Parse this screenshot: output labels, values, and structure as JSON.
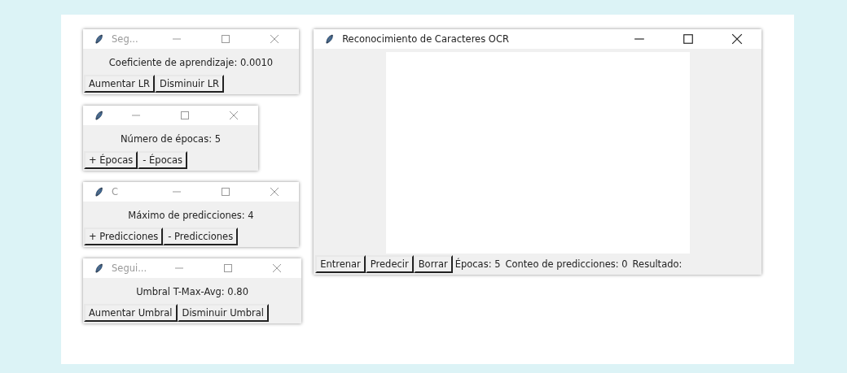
{
  "small_windows": [
    {
      "title": "Seg...",
      "label": "Coeficiente de aprendizaje: 0.0010",
      "buttons": [
        "Aumentar LR",
        "Disminuir LR"
      ]
    },
    {
      "label": "Número de épocas: 5",
      "buttons": [
        "+ Épocas",
        "- Épocas"
      ]
    },
    {
      "title": "C",
      "label": "Máximo de predicciones: 4",
      "buttons": [
        "+ Predicciones",
        "- Predicciones"
      ]
    },
    {
      "title": "Segui...",
      "label": "Umbral T-Max-Avg: 0.80",
      "buttons": [
        "Aumentar Umbral",
        "Disminuir Umbral"
      ]
    }
  ],
  "main_window": {
    "title": "Reconocimiento de Caracteres OCR",
    "buttons": [
      "Entrenar",
      "Predecir",
      "Borrar"
    ],
    "status": [
      "Épocas: 5",
      "Conteo de predicciones: 0",
      "Resultado:"
    ]
  }
}
